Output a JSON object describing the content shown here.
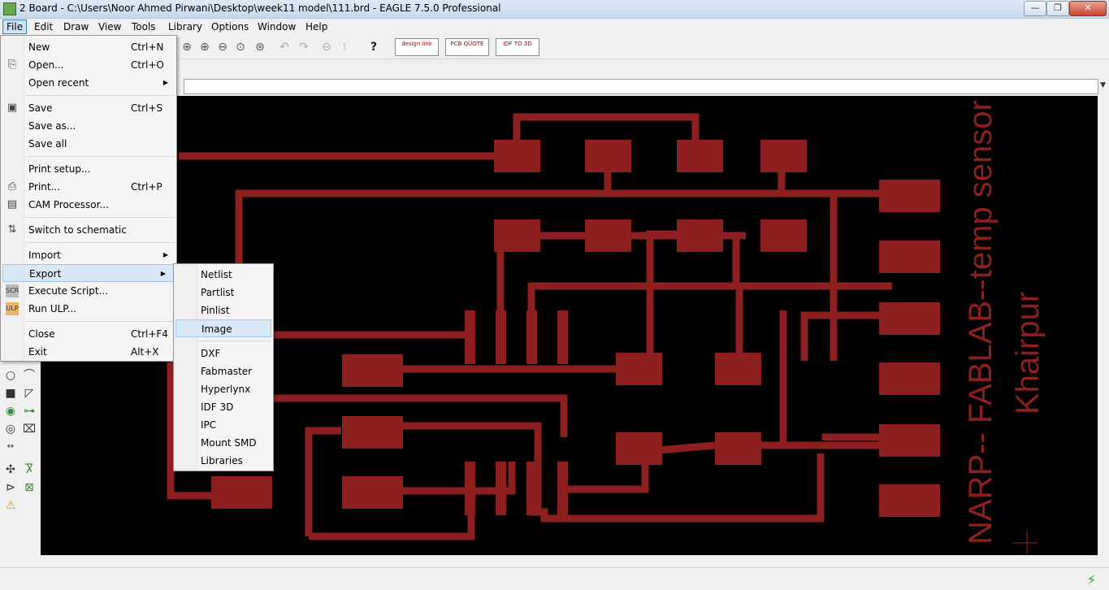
{
  "window": {
    "title": "2 Board - C:\\Users\\Noor Ahmed Pirwani\\Desktop\\week11 model\\111.brd - EAGLE 7.5.0 Professional",
    "minimize_glyph": "—",
    "maximize_glyph": "❐",
    "close_glyph": "✕"
  },
  "menubar": [
    {
      "label": "File"
    },
    {
      "label": "Edit"
    },
    {
      "label": "Draw"
    },
    {
      "label": "View"
    },
    {
      "label": "Tools"
    },
    {
      "label": "Library"
    },
    {
      "label": "Options"
    },
    {
      "label": "Window"
    },
    {
      "label": "Help"
    }
  ],
  "toolbar": {
    "design_link": "design link",
    "pcb_quote": "PCB QUOTE",
    "idf_to_3d": "IDF TO 3D"
  },
  "file_menu": [
    {
      "label": "New",
      "shortcut": "Ctrl+N",
      "icon": ""
    },
    {
      "label": "Open...",
      "shortcut": "Ctrl+O",
      "icon": "folder-icon"
    },
    {
      "label": "Open recent",
      "shortcut": "",
      "arrow": "▶"
    },
    {
      "label": "Save",
      "shortcut": "Ctrl+S",
      "icon": "floppy-icon"
    },
    {
      "label": "Save as...",
      "shortcut": ""
    },
    {
      "label": "Save all",
      "shortcut": ""
    },
    {
      "label": "Print setup...",
      "shortcut": ""
    },
    {
      "label": "Print...",
      "shortcut": "Ctrl+P",
      "icon": "printer-icon"
    },
    {
      "label": "CAM Processor...",
      "shortcut": "",
      "icon": "cam-icon"
    },
    {
      "label": "Switch to schematic",
      "shortcut": "",
      "icon": "switch-icon"
    },
    {
      "label": "Import",
      "shortcut": "",
      "arrow": "▶"
    },
    {
      "label": "Export",
      "shortcut": "",
      "arrow": "▶"
    },
    {
      "label": "Execute Script...",
      "shortcut": "",
      "icon": "script-icon"
    },
    {
      "label": "Run ULP...",
      "shortcut": "",
      "icon": "ulp-icon"
    },
    {
      "label": "Close",
      "shortcut": "Ctrl+F4"
    },
    {
      "label": "Exit",
      "shortcut": "Alt+X"
    }
  ],
  "export_menu": [
    {
      "label": "Netlist"
    },
    {
      "label": "Partlist"
    },
    {
      "label": "Pinlist"
    },
    {
      "label": "Image"
    },
    {
      "label": "DXF"
    },
    {
      "label": "Fabmaster"
    },
    {
      "label": "Hyperlynx"
    },
    {
      "label": "IDF 3D"
    },
    {
      "label": "IPC"
    },
    {
      "label": "Mount SMD"
    },
    {
      "label": "Libraries"
    }
  ],
  "board": {
    "text_line1": "NARP-- FABLAB--temp sensor",
    "text_line2": "Khairpur",
    "trace_color": "#8e1f1f",
    "background": "#000000"
  },
  "colors": {
    "accent": "#3c7fb1",
    "highlight": "#d9e8f7"
  }
}
